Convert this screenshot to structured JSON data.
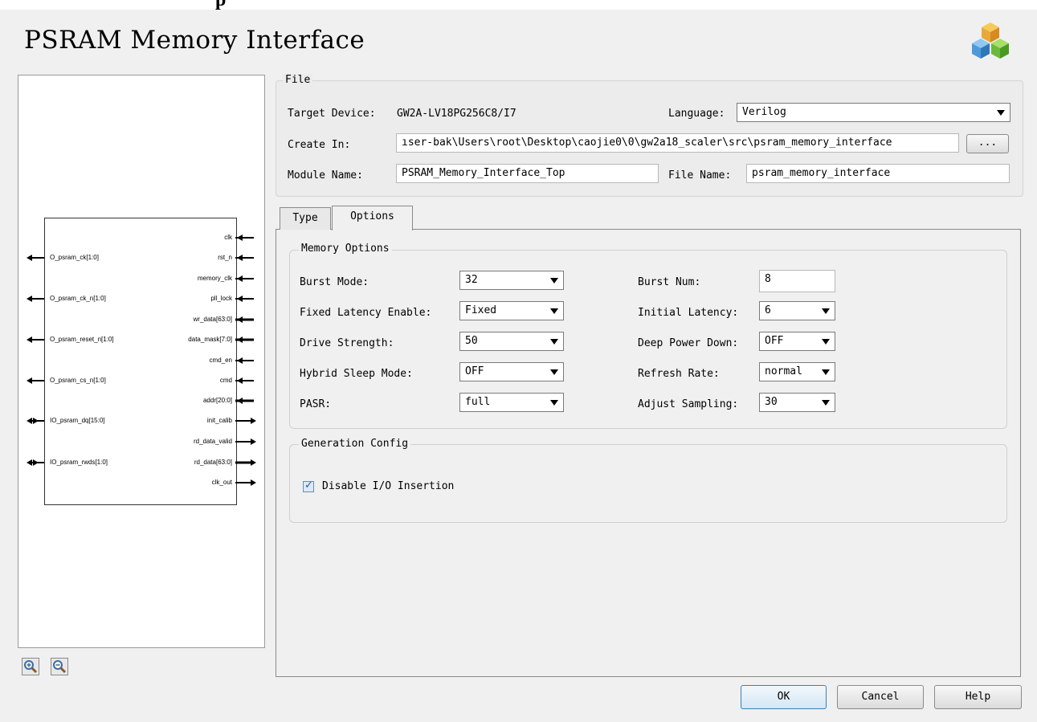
{
  "header": {
    "partial_text": "p",
    "title": "PSRAM Memory Interface",
    "logo_icon": "cubes-logo-icon"
  },
  "diagram": {
    "left_ports": [
      "O_psram_ck[1:0]",
      "O_psram_ck_n[1:0]",
      "O_psram_reset_n[1:0]",
      "O_psram_cs_n[1:0]",
      "IO_psram_dq[15:0]",
      "IO_psram_rwds[1:0]"
    ],
    "right_ports": [
      "clk",
      "rst_n",
      "memory_clk",
      "pll_lock",
      "wr_data[63:0]",
      "data_mask[7:0]",
      "cmd_en",
      "cmd",
      "addr[20:0]",
      "init_calib",
      "rd_data_valid",
      "rd_data[63:0]",
      "clk_out"
    ],
    "zoom_in_icon": "zoom-in-icon",
    "zoom_out_icon": "zoom-out-icon"
  },
  "file": {
    "group_title": "File",
    "target_device_label": "Target Device:",
    "target_device_value": "GW2A-LV18PG256C8/I7",
    "language_label": "Language:",
    "language_value": "Verilog",
    "create_in_label": "Create In:",
    "create_in_value": "ıser-bak\\Users\\root\\Desktop\\caojie0\\0\\gw2a18_scaler\\src\\psram_memory_interface",
    "browse_label": "...",
    "module_name_label": "Module Name:",
    "module_name_value": "PSRAM_Memory_Interface_Top",
    "file_name_label": "File Name:",
    "file_name_value": "psram_memory_interface"
  },
  "tabs": [
    {
      "label": "Type"
    },
    {
      "label": "Options"
    }
  ],
  "memory_options": {
    "title": "Memory Options",
    "burst_mode_label": "Burst Mode:",
    "burst_mode_value": "32",
    "burst_num_label": "Burst Num:",
    "burst_num_value": "8",
    "fixed_latency_label": "Fixed Latency Enable:",
    "fixed_latency_value": "Fixed",
    "initial_latency_label": "Initial Latency:",
    "initial_latency_value": "6",
    "drive_strength_label": "Drive Strength:",
    "drive_strength_value": "50",
    "deep_power_down_label": "Deep Power Down:",
    "deep_power_down_value": "OFF",
    "hybrid_sleep_label": "Hybrid Sleep Mode:",
    "hybrid_sleep_value": "OFF",
    "refresh_rate_label": "Refresh Rate:",
    "refresh_rate_value": "normal",
    "pasr_label": "PASR:",
    "pasr_value": "full",
    "adjust_sampling_label": "Adjust Sampling:",
    "adjust_sampling_value": "30"
  },
  "generation_config": {
    "title": "Generation Config",
    "disable_io_label": "Disable I/O Insertion",
    "disable_io_checked": true
  },
  "buttons": {
    "ok": "OK",
    "cancel": "Cancel",
    "help": "Help"
  }
}
